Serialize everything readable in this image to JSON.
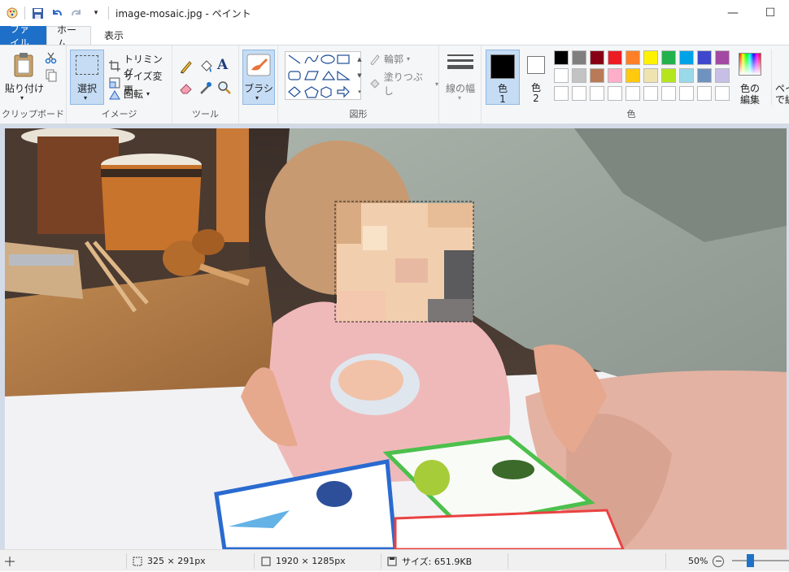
{
  "window": {
    "title": "image-mosaic.jpg - ペイント",
    "minimize": "—",
    "maximize": "☐"
  },
  "tabs": [
    {
      "label": "ファイル"
    },
    {
      "label": "ホーム"
    },
    {
      "label": "表示"
    }
  ],
  "clipboard": {
    "paste_label": "貼り付け",
    "group_label": "クリップボード"
  },
  "image": {
    "select_label": "選択",
    "crop_label": "トリミング",
    "resize_label": "サイズ変更",
    "rotate_label": "回転",
    "group_label": "イメージ"
  },
  "tools": {
    "group_label": "ツール"
  },
  "brush": {
    "label": "ブラシ"
  },
  "shapes": {
    "outline_label": "輪郭",
    "fill_label": "塗りつぶし",
    "group_label": "図形"
  },
  "size": {
    "label": "線の幅"
  },
  "colors": {
    "color1_label": "色",
    "color1_num": "1",
    "color2_label": "色",
    "color2_num": "2",
    "edit_label_1": "色の",
    "edit_label_2": "編集",
    "paint3d_label_1": "ペイ",
    "paint3d_label_2": "で編",
    "group_label": "色",
    "color1": "#000000",
    "color2": "#ffffff",
    "palette_row1": [
      "#000000",
      "#7f7f7f",
      "#880015",
      "#ed1c24",
      "#ff7f27",
      "#fff200",
      "#22b14c",
      "#00a2e8",
      "#3f48cc",
      "#a349a4"
    ],
    "palette_row2": [
      "#ffffff",
      "#c3c3c3",
      "#b97a57",
      "#ffaec9",
      "#ffc90e",
      "#efe4b0",
      "#b5e61d",
      "#99d9ea",
      "#7092be",
      "#c8bfe7"
    ],
    "palette_row3": [
      "#ffffff",
      "#ffffff",
      "#ffffff",
      "#ffffff",
      "#ffffff",
      "#ffffff",
      "#ffffff",
      "#ffffff",
      "#ffffff",
      "#ffffff"
    ]
  },
  "status": {
    "selection_size": "325 × 291px",
    "image_size": "1920 × 1285px",
    "file_size": "サイズ: 651.9KB",
    "zoom": "50%"
  }
}
